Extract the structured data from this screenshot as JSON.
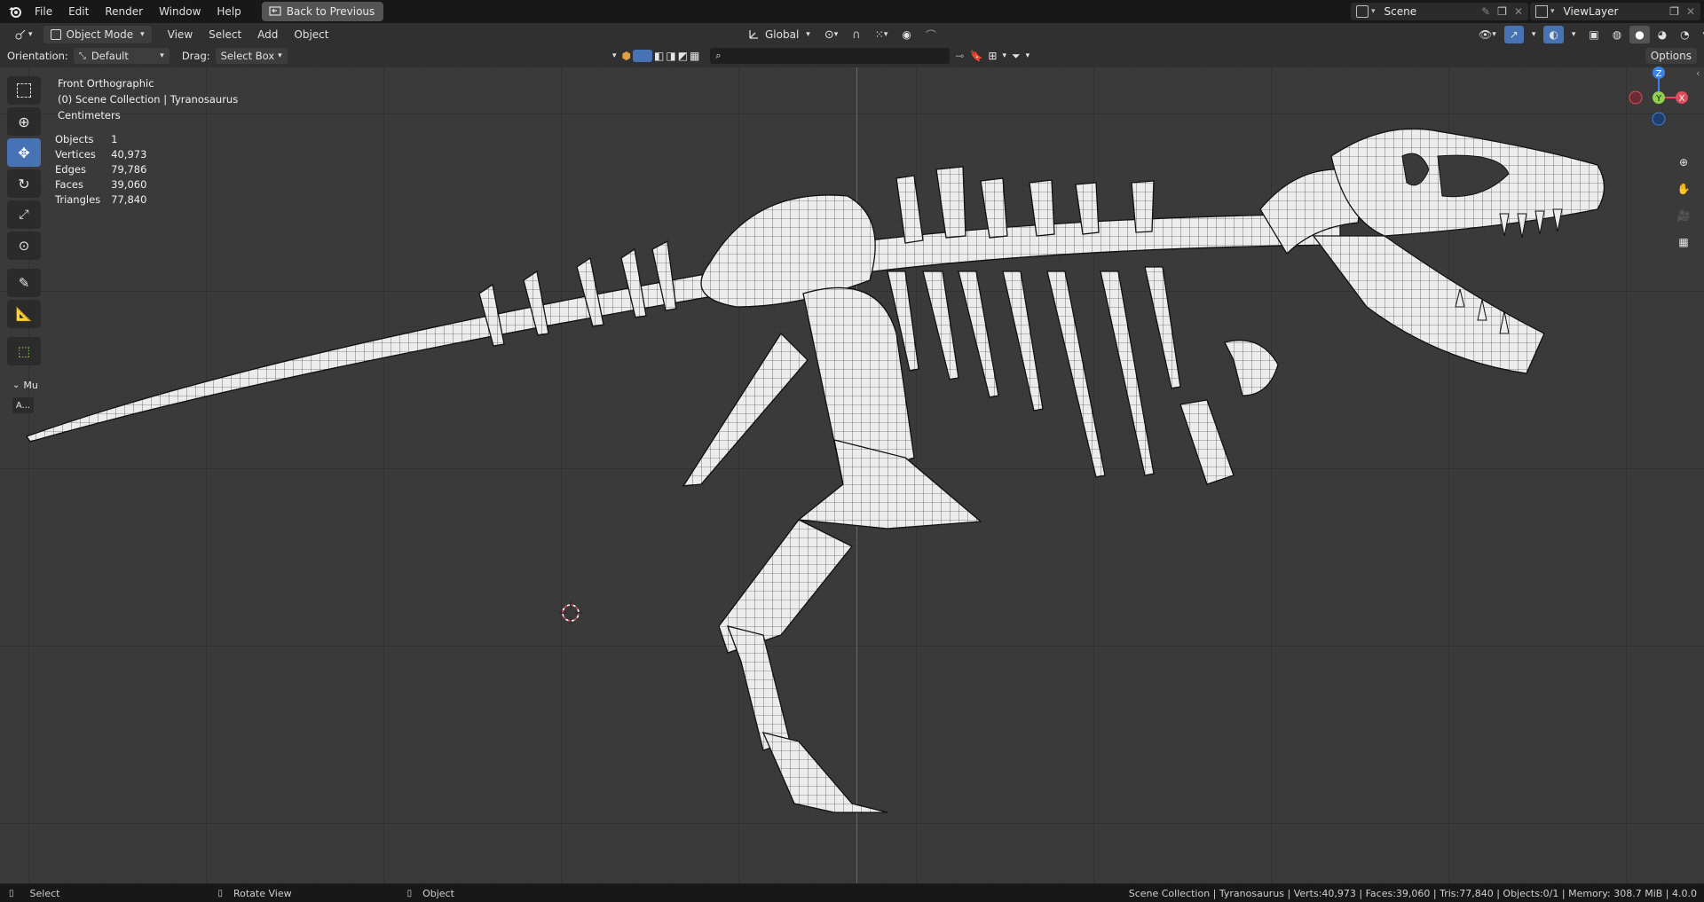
{
  "menu": {
    "items": [
      "File",
      "Edit",
      "Render",
      "Window",
      "Help"
    ],
    "back_button": "Back to Previous"
  },
  "scene": {
    "name": "Scene",
    "view_layer": "ViewLayer"
  },
  "header": {
    "mode": "Object Mode",
    "menus": [
      "View",
      "Select",
      "Add",
      "Object"
    ],
    "transform_orientation": "Global",
    "options_label": "Options"
  },
  "tool_settings": {
    "orientation_label": "Orientation:",
    "orientation_value": "Default",
    "drag_label": "Drag:",
    "drag_value": "Select Box"
  },
  "overlay_info": {
    "view_name": "Front Orthographic",
    "collection_path": "(0) Scene Collection | Tyranosaurus",
    "units": "Centimeters",
    "stats": [
      {
        "label": "Objects",
        "value": "1"
      },
      {
        "label": "Vertices",
        "value": "40,973"
      },
      {
        "label": "Edges",
        "value": "79,786"
      },
      {
        "label": "Faces",
        "value": "39,060"
      },
      {
        "label": "Triangles",
        "value": "77,840"
      }
    ]
  },
  "toolbar": {
    "tools": [
      {
        "name": "select-box-icon",
        "active": false
      },
      {
        "name": "cursor-icon",
        "active": false
      },
      {
        "name": "move-icon",
        "active": true
      },
      {
        "name": "rotate-icon",
        "active": false
      },
      {
        "name": "scale-icon",
        "active": false
      },
      {
        "name": "transform-icon",
        "active": false
      },
      {
        "name": "annotate-icon",
        "active": false
      },
      {
        "name": "measure-icon",
        "active": false
      },
      {
        "name": "add-cube-icon",
        "active": false
      }
    ],
    "panel_collapsed_label": "Mu",
    "panel_button": "A..."
  },
  "gizmo": {
    "z": "Z",
    "y": "Y",
    "x": "X"
  },
  "statusbar": {
    "select": "Select",
    "rotate_view": "Rotate View",
    "object": "Object",
    "scene_stats": "Scene Collection | Tyranosaurus | Verts:40,973 | Faces:39,060 | Tris:77,840 | Objects:0/1 | Memory: 308.7 MiB | 4.0.0"
  },
  "colors": {
    "accent": "#4772b3",
    "axis_x": "#e34b5a",
    "axis_y": "#8fd14f",
    "axis_z": "#3b82e8",
    "mesh_fill": "#ececec",
    "mesh_wire": "#1a1a1a"
  }
}
